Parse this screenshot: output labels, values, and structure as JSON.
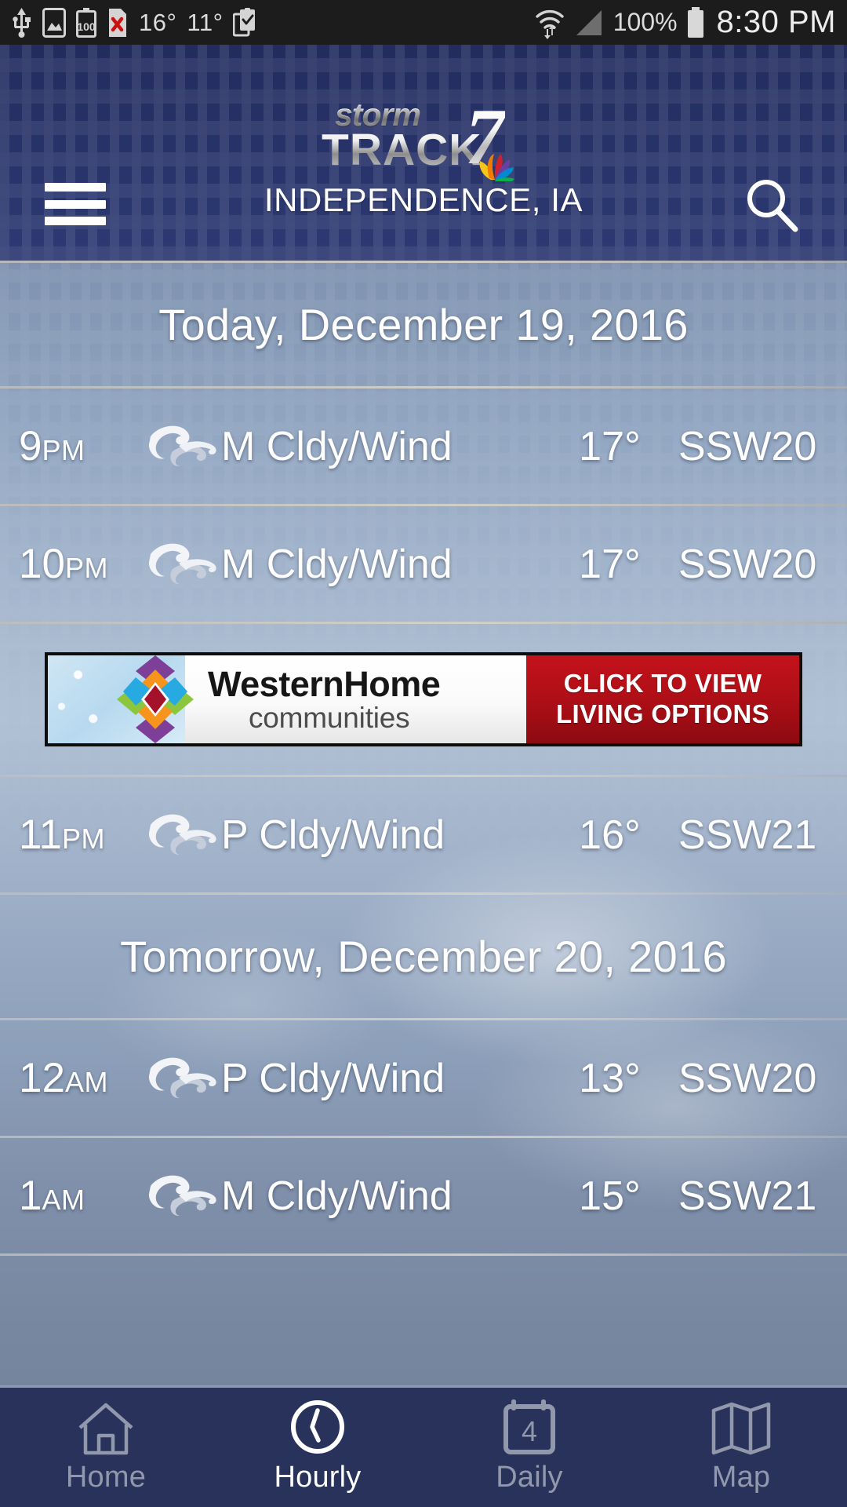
{
  "statusbar": {
    "icons": [
      "usb-icon",
      "screenshot-icon",
      "battery-100-icon",
      "sim-error-icon",
      "clipboard-check-icon",
      "wifi-icon",
      "signal-icon"
    ],
    "temp_high": "16°",
    "temp_low": "11°",
    "battery_percent": "100%",
    "time": "8:30 PM"
  },
  "header": {
    "menu_icon": "hamburger-icon",
    "search_icon": "search-icon",
    "logo": {
      "storm": "storm",
      "track": "TRACK",
      "seven": "7",
      "peacock": "nbc-peacock-icon"
    },
    "city": "INDEPENDENCE, IA",
    "bg_color": "#28336a"
  },
  "list": [
    {
      "kind": "day-header",
      "label": "Today, December 19, 2016"
    },
    {
      "kind": "hour",
      "time": "9",
      "meridiem": "PM",
      "icon": "wind-icon",
      "condition": "M Cldy/Wind",
      "temp": "17°",
      "wind": "SSW20"
    },
    {
      "kind": "hour",
      "time": "10",
      "meridiem": "PM",
      "icon": "wind-icon",
      "condition": "M Cldy/Wind",
      "temp": "17°",
      "wind": "SSW20"
    },
    {
      "kind": "ad",
      "brand_name": "WesternHome",
      "brand_sub": "communities",
      "cta_line1": "CLICK TO VIEW",
      "cta_line2": "LIVING OPTIONS",
      "cta_color": "#b00f17"
    },
    {
      "kind": "hour",
      "time": "11",
      "meridiem": "PM",
      "icon": "wind-icon",
      "condition": "P Cldy/Wind",
      "temp": "16°",
      "wind": "SSW21"
    },
    {
      "kind": "day-header",
      "label": "Tomorrow, December 20, 2016"
    },
    {
      "kind": "hour",
      "time": "12",
      "meridiem": "AM",
      "icon": "wind-icon",
      "condition": "P Cldy/Wind",
      "temp": "13°",
      "wind": "SSW20"
    },
    {
      "kind": "hour",
      "time": "1",
      "meridiem": "AM",
      "icon": "wind-icon",
      "condition": "M Cldy/Wind",
      "temp": "15°",
      "wind": "SSW21"
    }
  ],
  "bottomnav": {
    "bg_color": "#28325a",
    "items": [
      {
        "label": "Home",
        "icon": "home-icon",
        "active": false
      },
      {
        "label": "Hourly",
        "icon": "clock-icon",
        "active": true
      },
      {
        "label": "Daily",
        "icon": "calendar-icon",
        "active": false,
        "badge": "4"
      },
      {
        "label": "Map",
        "icon": "map-icon",
        "active": false
      }
    ]
  }
}
